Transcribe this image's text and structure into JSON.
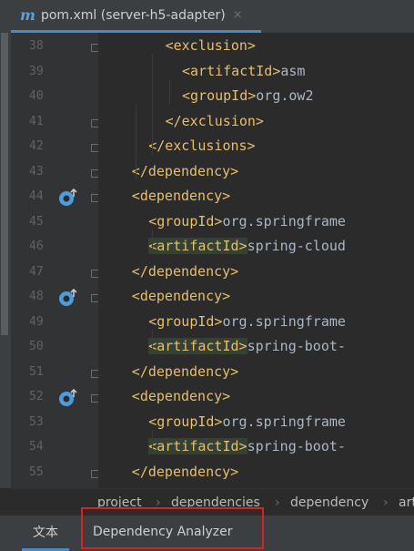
{
  "editor_tab": {
    "icon": "m",
    "title": "pom.xml (server-h5-adapter)",
    "close": "×"
  },
  "left_cut_text": "i",
  "lines": [
    {
      "n": "38",
      "indent": 8,
      "parts": [
        [
          "t",
          "<exclusion>"
        ]
      ],
      "fold": true
    },
    {
      "n": "39",
      "indent": 10,
      "parts": [
        [
          "t",
          "<artifactId>"
        ],
        [
          "txt",
          "asm"
        ]
      ]
    },
    {
      "n": "40",
      "indent": 10,
      "parts": [
        [
          "t",
          "<groupId>"
        ],
        [
          "txt",
          "org.ow2"
        ]
      ]
    },
    {
      "n": "41",
      "indent": 8,
      "parts": [
        [
          "t",
          "</exclusion>"
        ]
      ],
      "fold": true
    },
    {
      "n": "42",
      "indent": 6,
      "parts": [
        [
          "t",
          "</exclusions>"
        ]
      ],
      "fold": true
    },
    {
      "n": "43",
      "indent": 4,
      "parts": [
        [
          "t",
          "</dependency>"
        ]
      ],
      "fold": true
    },
    {
      "n": "44",
      "indent": 4,
      "parts": [
        [
          "t",
          "<dependency>"
        ]
      ],
      "fold": true,
      "marker": true
    },
    {
      "n": "45",
      "indent": 6,
      "parts": [
        [
          "t",
          "<groupId>"
        ],
        [
          "txt",
          "org.springframe"
        ]
      ]
    },
    {
      "n": "46",
      "indent": 6,
      "parts": [
        [
          "hl",
          "<artifactId>"
        ],
        [
          "txt",
          "spring-cloud"
        ]
      ]
    },
    {
      "n": "47",
      "indent": 4,
      "parts": [
        [
          "t",
          "</dependency>"
        ]
      ],
      "fold": true
    },
    {
      "n": "48",
      "indent": 4,
      "parts": [
        [
          "t",
          "<dependency>"
        ]
      ],
      "fold": true,
      "marker": true
    },
    {
      "n": "49",
      "indent": 6,
      "parts": [
        [
          "t",
          "<groupId>"
        ],
        [
          "txt",
          "org.springframe"
        ]
      ]
    },
    {
      "n": "50",
      "indent": 6,
      "parts": [
        [
          "hl",
          "<artifactId>"
        ],
        [
          "txt",
          "spring-boot-"
        ]
      ]
    },
    {
      "n": "51",
      "indent": 4,
      "parts": [
        [
          "t",
          "</dependency>"
        ]
      ],
      "fold": true
    },
    {
      "n": "52",
      "indent": 4,
      "parts": [
        [
          "t",
          "<dependency>"
        ]
      ],
      "fold": true,
      "marker": true
    },
    {
      "n": "53",
      "indent": 6,
      "parts": [
        [
          "t",
          "<groupId>"
        ],
        [
          "txt",
          "org.springframe"
        ]
      ]
    },
    {
      "n": "54",
      "indent": 6,
      "parts": [
        [
          "hl",
          "<artifactId>"
        ],
        [
          "txt",
          "spring-boot-"
        ]
      ]
    },
    {
      "n": "55",
      "indent": 4,
      "parts": [
        [
          "t",
          "</dependency>"
        ]
      ],
      "fold": true
    }
  ],
  "breadcrumb": [
    "project",
    "dependencies",
    "dependency",
    "art"
  ],
  "bottom_tabs": {
    "text": "文本",
    "analyzer": "Dependency Analyzer"
  },
  "colors": {
    "accent": "#4a88c7",
    "highlight_box": "#e0201f"
  }
}
